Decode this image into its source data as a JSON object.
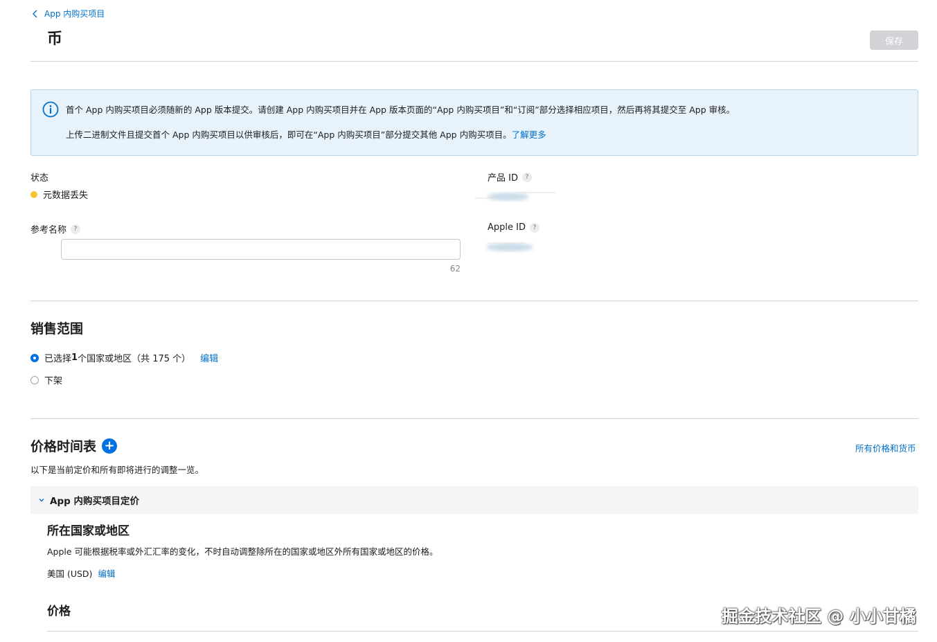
{
  "header": {
    "back_label": "App 内购买项目",
    "title": "币",
    "save_label": "保存"
  },
  "banner": {
    "line1": "首个 App 内购买项目必须随新的 App 版本提交。请创建 App 内购买项目并在 App 版本页面的“App 内购买项目”和“订阅”部分选择相应项目，然后再将其提交至 App 审核。",
    "line2": "上传二进制文件且提交首个 App 内购买项目以供审核后，即可在“App 内购买项目”部分提交其他 App 内购买项目。",
    "learn_more": "了解更多"
  },
  "details": {
    "status_label": "状态",
    "status_value": "元数据丢失",
    "status_color": "#f5c230",
    "product_id_label": "产品 ID",
    "reference_name_label": "参考名称",
    "reference_name_value": "",
    "reference_name_counter": "62",
    "apple_id_label": "Apple ID",
    "help_mark": "?"
  },
  "availability": {
    "title": "销售范围",
    "option_selected_prefix": "已选择 ",
    "option_selected_count": "1",
    "option_selected_suffix": " 个国家或地区（共 175 个）",
    "edit_label": "编辑",
    "option_remove": "下架"
  },
  "price_schedule": {
    "title": "价格时间表",
    "add_icon": "+",
    "all_prices_link": "所有价格和货币",
    "description": "以下是当前定价和所有即将进行的调整一览。",
    "section_label": "App 内购买项目定价",
    "base_country_title": "所在国家或地区",
    "base_country_desc": "Apple 可能根据税率或外汇汇率的变化，不时自动调整除所在的国家或地区外所有国家或地区的价格。",
    "base_country_value": "美国 (USD)",
    "edit_label": "编辑",
    "price_title": "价格"
  },
  "watermark": "掘金技术社区 @ 小小甘橘",
  "colors": {
    "accent": "#0071e3",
    "link": "#0070c9",
    "banner_bg": "#e8f2fa",
    "disabled_button": "#d2d2d7"
  }
}
